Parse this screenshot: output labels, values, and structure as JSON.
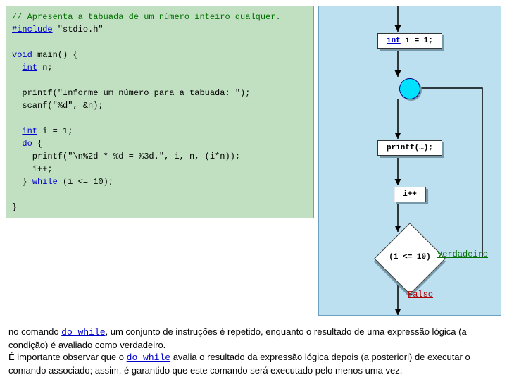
{
  "code": {
    "c1": "// Apresenta a tabuada de um número inteiro qualquer.",
    "inc1": "#include",
    "inc2": " \"stdio.h\"",
    "void": "void",
    "main_rest": " main() {",
    "int": "int",
    "n_decl": " n;",
    "printf1": "  printf(\"Informe um número para a tabuada: \");",
    "scanf": "  scanf(\"%d\", &n);",
    "i_decl": " i = 1;",
    "do": "do",
    "open_brace": " {",
    "pf2": "    printf(\"\\n%2d * %d = %3d.\", i, n, (i*n));",
    "ipp": "    i++;",
    "close": "  } ",
    "while": "while",
    "cond": " (i <= 10);",
    "end": "}"
  },
  "flow": {
    "n1": "int",
    "n1b": " i = 1;",
    "n2": "printf(…);",
    "n3": "i++",
    "d": "(i <= 10)",
    "t": "Verdadeiro",
    "f": "Falso"
  },
  "prose": {
    "p1a": "no comando ",
    "kw": "do while",
    "p1b": ", um conjunto de instruções é repetido, enquanto o resultado de uma expressão lógica (a condição) é avaliado como verdadeiro.",
    "p2a": "É importante observar que o ",
    "p2b": " avalia o resultado da expressão lógica depois (a posteriori) de executar o comando associado; assim, é garantido que este comando será executado pelo menos uma vez."
  }
}
